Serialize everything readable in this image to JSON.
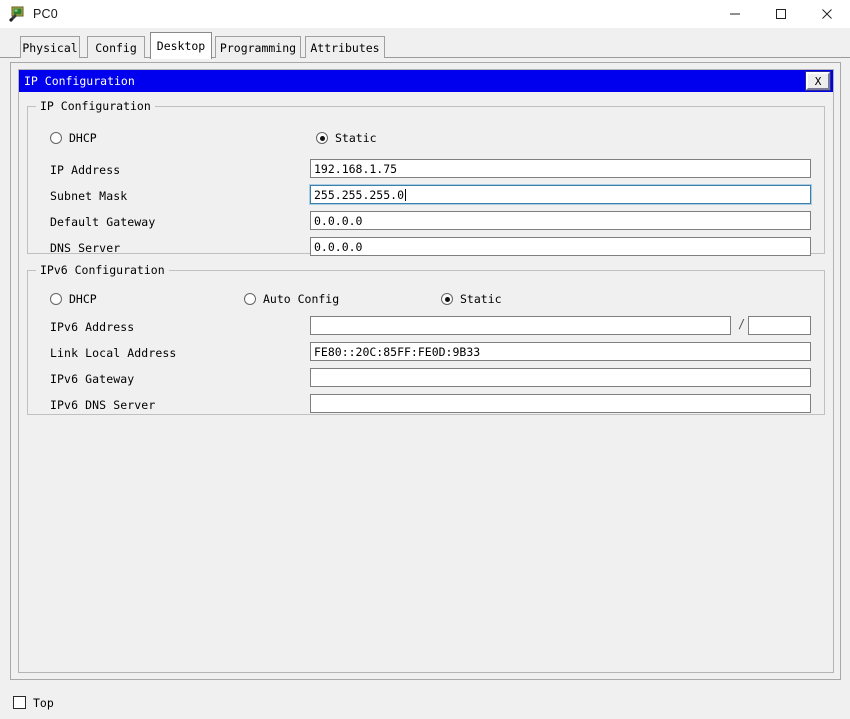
{
  "window": {
    "title": "PC0",
    "icon": "pc-device-icon",
    "controls": {
      "minimize": "─",
      "maximize": "☐",
      "close": "✕"
    }
  },
  "tabs": [
    {
      "label": "Physical",
      "active": false
    },
    {
      "label": "Config",
      "active": false
    },
    {
      "label": "Desktop",
      "active": true
    },
    {
      "label": "Programming",
      "active": false
    },
    {
      "label": "Attributes",
      "active": false
    }
  ],
  "ip_window": {
    "title": "IP Configuration",
    "close_label": "X",
    "title_bg": "#0000ee"
  },
  "ipv4": {
    "group_title": "IP Configuration",
    "modes": [
      {
        "label": "DHCP",
        "selected": false
      },
      {
        "label": "Static",
        "selected": true
      }
    ],
    "fields": [
      {
        "label": "IP Address",
        "value": "192.168.1.75",
        "focused": false
      },
      {
        "label": "Subnet Mask",
        "value": "255.255.255.0",
        "focused": true
      },
      {
        "label": "Default Gateway",
        "value": "0.0.0.0",
        "focused": false
      },
      {
        "label": "DNS Server",
        "value": "0.0.0.0",
        "focused": false
      }
    ]
  },
  "ipv6": {
    "group_title": "IPv6 Configuration",
    "modes": [
      {
        "label": "DHCP",
        "selected": false
      },
      {
        "label": "Auto Config",
        "selected": false
      },
      {
        "label": "Static",
        "selected": true
      }
    ],
    "address_label": "IPv6 Address",
    "address_value": "",
    "prefix_separator": "/",
    "prefix_value": "",
    "fields": [
      {
        "label": "Link Local Address",
        "value": "FE80::20C:85FF:FE0D:9B33"
      },
      {
        "label": "IPv6 Gateway",
        "value": ""
      },
      {
        "label": "IPv6 DNS Server",
        "value": ""
      }
    ]
  },
  "bottom": {
    "top_checkbox_label": "Top",
    "top_checked": false
  }
}
